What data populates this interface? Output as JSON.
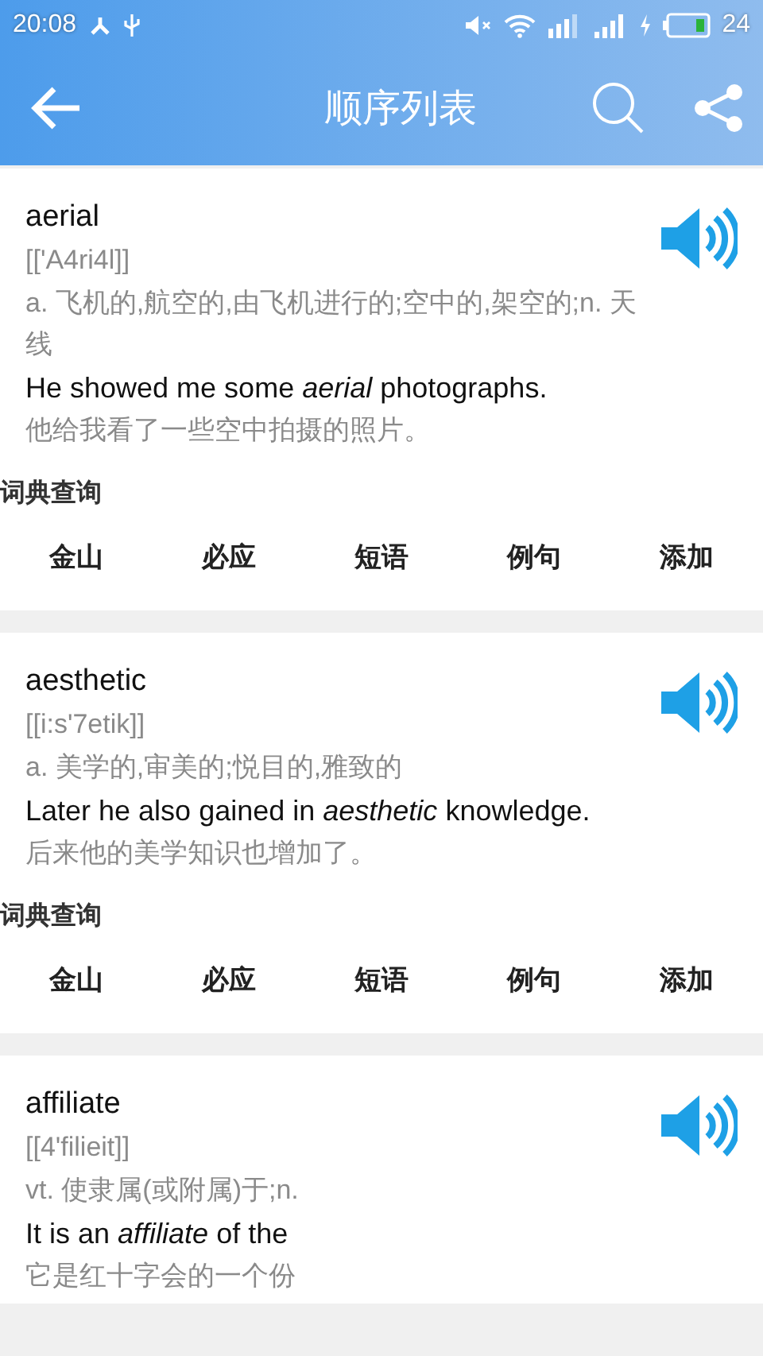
{
  "status_bar": {
    "time": "20:08",
    "battery": "24"
  },
  "header": {
    "title": "顺序列表"
  },
  "entries": [
    {
      "word": "aerial",
      "phonetic": "[['A4ri4l]]",
      "definition": "a. 飞机的,航空的,由飞机进行的;空中的,架空的;n. 天线",
      "example": "He showed me some *aerial* photographs.",
      "translation": "他给我看了一些空中拍摄的照片。",
      "section_label": "词典查询",
      "actions": [
        "金山",
        "必应",
        "短语",
        "例句",
        "添加"
      ]
    },
    {
      "word": "aesthetic",
      "phonetic": "[[i:s'7etik]]",
      "definition": "a. 美学的,审美的;悦目的,雅致的",
      "example": "Later he also gained in *aesthetic* knowledge.",
      "translation": "后来他的美学知识也增加了。",
      "section_label": "词典查询",
      "actions": [
        "金山",
        "必应",
        "短语",
        "例句",
        "添加"
      ]
    },
    {
      "word": "affiliate",
      "phonetic": "[[4'filieit]]",
      "definition": "vt. 使隶属(或附属)于;n.",
      "example": "It is an *affiliate* of the",
      "translation": "它是红十字会的一个份"
    }
  ]
}
